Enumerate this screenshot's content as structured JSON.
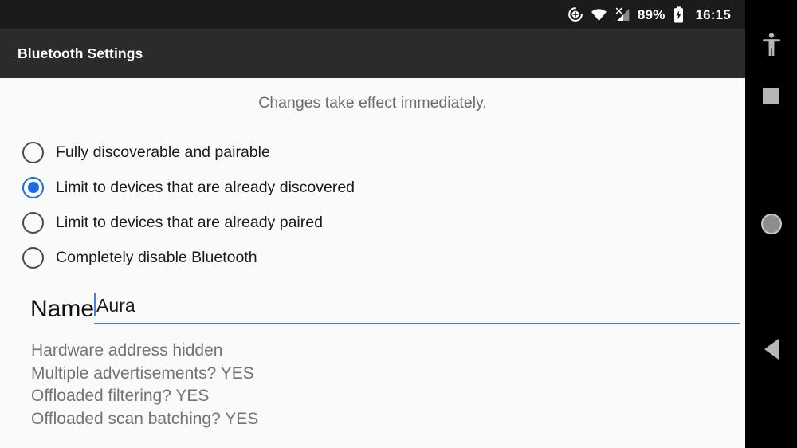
{
  "status_bar": {
    "icons": [
      "location-icon",
      "wifi-icon",
      "cellular-no-signal-icon"
    ],
    "battery_percent": "89%",
    "battery_icon": "battery-charging-icon",
    "time": "16:15"
  },
  "action_bar": {
    "title": "Bluetooth Settings"
  },
  "content": {
    "hint": "Changes take effect immediately.",
    "radio_options": [
      {
        "label": "Fully discoverable and pairable",
        "checked": false
      },
      {
        "label": "Limit to devices that are already discovered",
        "checked": true
      },
      {
        "label": "Limit to devices that are already paired",
        "checked": false
      },
      {
        "label": "Completely disable Bluetooth",
        "checked": false
      }
    ],
    "name_field": {
      "label": "Name",
      "value": "Aura",
      "placeholder": "Name"
    },
    "info_lines": [
      "Hardware address hidden",
      "Multiple advertisements? YES",
      "Offloaded filtering? YES",
      "Offloaded scan batching? YES"
    ]
  },
  "nav_bar": {
    "buttons": [
      {
        "icon": "accessibility-icon"
      },
      {
        "icon": "recents-square-icon"
      },
      {
        "icon": "home-circle-icon"
      },
      {
        "icon": "back-triangle-icon"
      }
    ]
  },
  "colors": {
    "accent": "#1b6ee0",
    "underline": "#4a7fe0",
    "action_bar": "#2b2b2b",
    "status_bar": "#1b1b1b",
    "page_bg": "#fafafa",
    "nav_bg": "#000000"
  }
}
